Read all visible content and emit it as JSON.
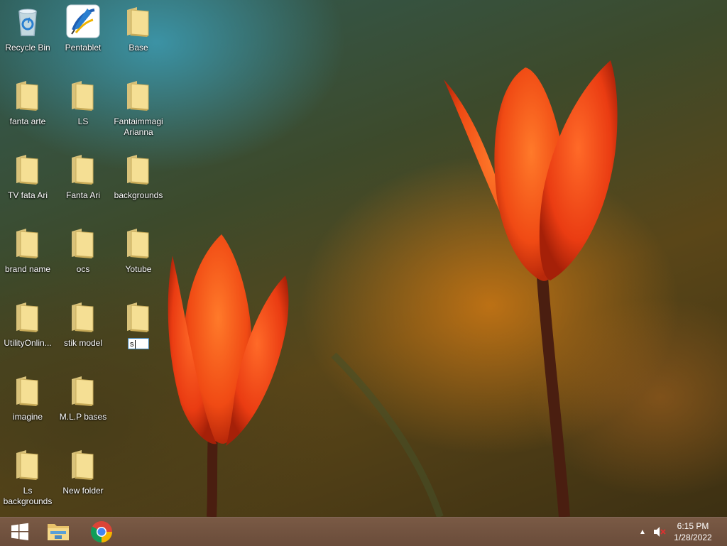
{
  "desktop": {
    "icons": [
      {
        "label": "Recycle Bin",
        "type": "recycle"
      },
      {
        "label": "Pentablet",
        "type": "app"
      },
      {
        "label": "Base",
        "type": "folder"
      },
      {
        "label": "fanta arte",
        "type": "folder"
      },
      {
        "label": "LS",
        "type": "folder"
      },
      {
        "label": "Fantaimmagi Arianna",
        "type": "folder"
      },
      {
        "label": "TV  fata Ari",
        "type": "folder"
      },
      {
        "label": "Fanta Ari",
        "type": "folder"
      },
      {
        "label": "backgrounds",
        "type": "folder"
      },
      {
        "label": "brand name",
        "type": "folder"
      },
      {
        "label": "ocs",
        "type": "folder"
      },
      {
        "label": "Yotube",
        "type": "folder"
      },
      {
        "label": "UtilityOnlin...",
        "type": "folder"
      },
      {
        "label": "stik  model",
        "type": "folder"
      },
      {
        "label": "imagine",
        "type": "folder"
      },
      {
        "label": "M.L.P bases",
        "type": "folder"
      },
      {
        "label": "Ls backgrounds",
        "type": "folder"
      },
      {
        "label": "New folder",
        "type": "folder"
      }
    ],
    "rename_field": {
      "value": "s"
    }
  },
  "taskbar": {
    "start": "windows-logo-icon",
    "pinned": [
      "file-explorer-icon",
      "chrome-icon"
    ],
    "tray": {
      "show_hidden": "▲",
      "volume": "volume-muted-icon"
    },
    "clock": {
      "time": "6:15 PM",
      "date": "1/28/2022"
    }
  }
}
